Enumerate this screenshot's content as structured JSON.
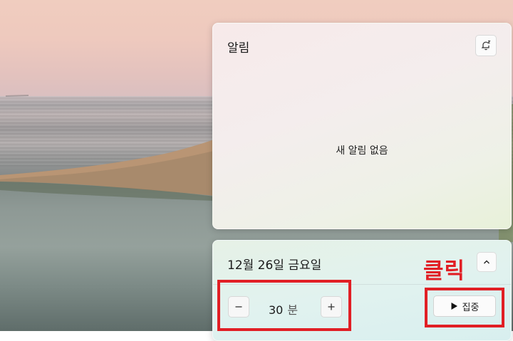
{
  "notification_panel": {
    "title": "알림",
    "dnd_icon": "bell-snooze-icon",
    "empty_message": "새 알림 없음"
  },
  "calendar_panel": {
    "date": "12월 26일 금요일",
    "collapse_icon": "chevron-up-icon",
    "focus": {
      "decrease_icon": "minus-icon",
      "increase_icon": "plus-icon",
      "value": "30",
      "unit": "분",
      "start_icon": "play-icon",
      "start_label": "집중"
    }
  },
  "annotation": {
    "label": "클릭",
    "color": "#e11f25"
  }
}
